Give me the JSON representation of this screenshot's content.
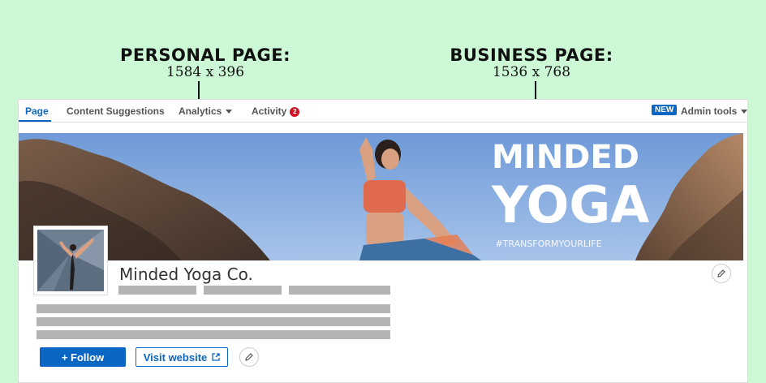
{
  "annotations": {
    "personal": {
      "title": "PERSONAL PAGE:",
      "dims": "1584 x 396"
    },
    "business": {
      "title": "BUSINESS PAGE:",
      "dims": "1536 x 768"
    }
  },
  "nav": {
    "items": [
      {
        "label": "Page",
        "active": true
      },
      {
        "label": "Content Suggestions"
      },
      {
        "label": "Analytics"
      },
      {
        "label": "Activity",
        "count": "2"
      }
    ],
    "new_badge": "NEW",
    "admin_tools": "Admin tools"
  },
  "banner": {
    "line1": "MINDED",
    "line2": "YOGA",
    "hashtag": "#TRANSFORMYOURLIFE"
  },
  "company": {
    "name": "Minded Yoga Co."
  },
  "actions": {
    "follow": "+ Follow",
    "visit": "Visit website"
  },
  "colors": {
    "accent": "#0a66c2",
    "background": "#cdf8d6",
    "badge": "#d11124"
  }
}
